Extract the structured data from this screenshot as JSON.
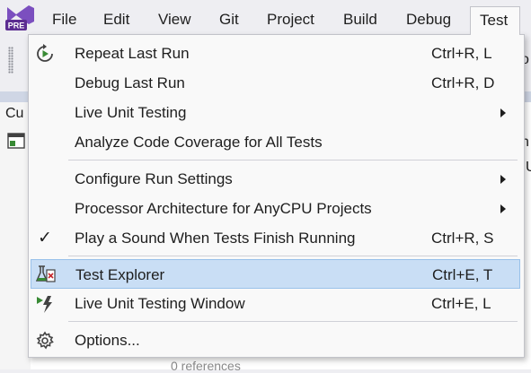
{
  "menubar": {
    "logo_badge": "PRE",
    "items": [
      "File",
      "Edit",
      "View",
      "Git",
      "Project",
      "Build",
      "Debug",
      "Test"
    ]
  },
  "background": {
    "left_tab": "Cu",
    "right_toolbar_fragment": "o",
    "right_code_fragment_1": "n",
    "right_code_fragment_2": "U",
    "references": "0 references"
  },
  "test_menu": {
    "items": [
      {
        "label": "Repeat Last Run",
        "shortcut": "Ctrl+R, L",
        "icon": "play-refresh-icon"
      },
      {
        "label": "Debug Last Run",
        "shortcut": "Ctrl+R, D"
      },
      {
        "label": "Live Unit Testing",
        "submenu": true
      },
      {
        "label": "Analyze Code Coverage for All Tests"
      },
      {
        "label": "Configure Run Settings",
        "submenu": true
      },
      {
        "label": "Processor Architecture for AnyCPU Projects",
        "submenu": true
      },
      {
        "label": "Play a Sound When Tests Finish Running",
        "shortcut": "Ctrl+R, S",
        "checked": true,
        "check_glyph": "✓"
      },
      {
        "label": "Test Explorer",
        "shortcut": "Ctrl+E, T",
        "icon": "test-explorer-icon",
        "highlighted": true
      },
      {
        "label": "Live Unit Testing Window",
        "shortcut": "Ctrl+E, L",
        "icon": "live-unit-testing-icon"
      },
      {
        "label": "Options...",
        "icon": "gear-icon"
      }
    ]
  },
  "colors": {
    "highlight_bg": "#c9def5",
    "highlight_border": "#99c1ea",
    "logo_purple": "#7b4fbf",
    "play_green": "#388a34"
  }
}
